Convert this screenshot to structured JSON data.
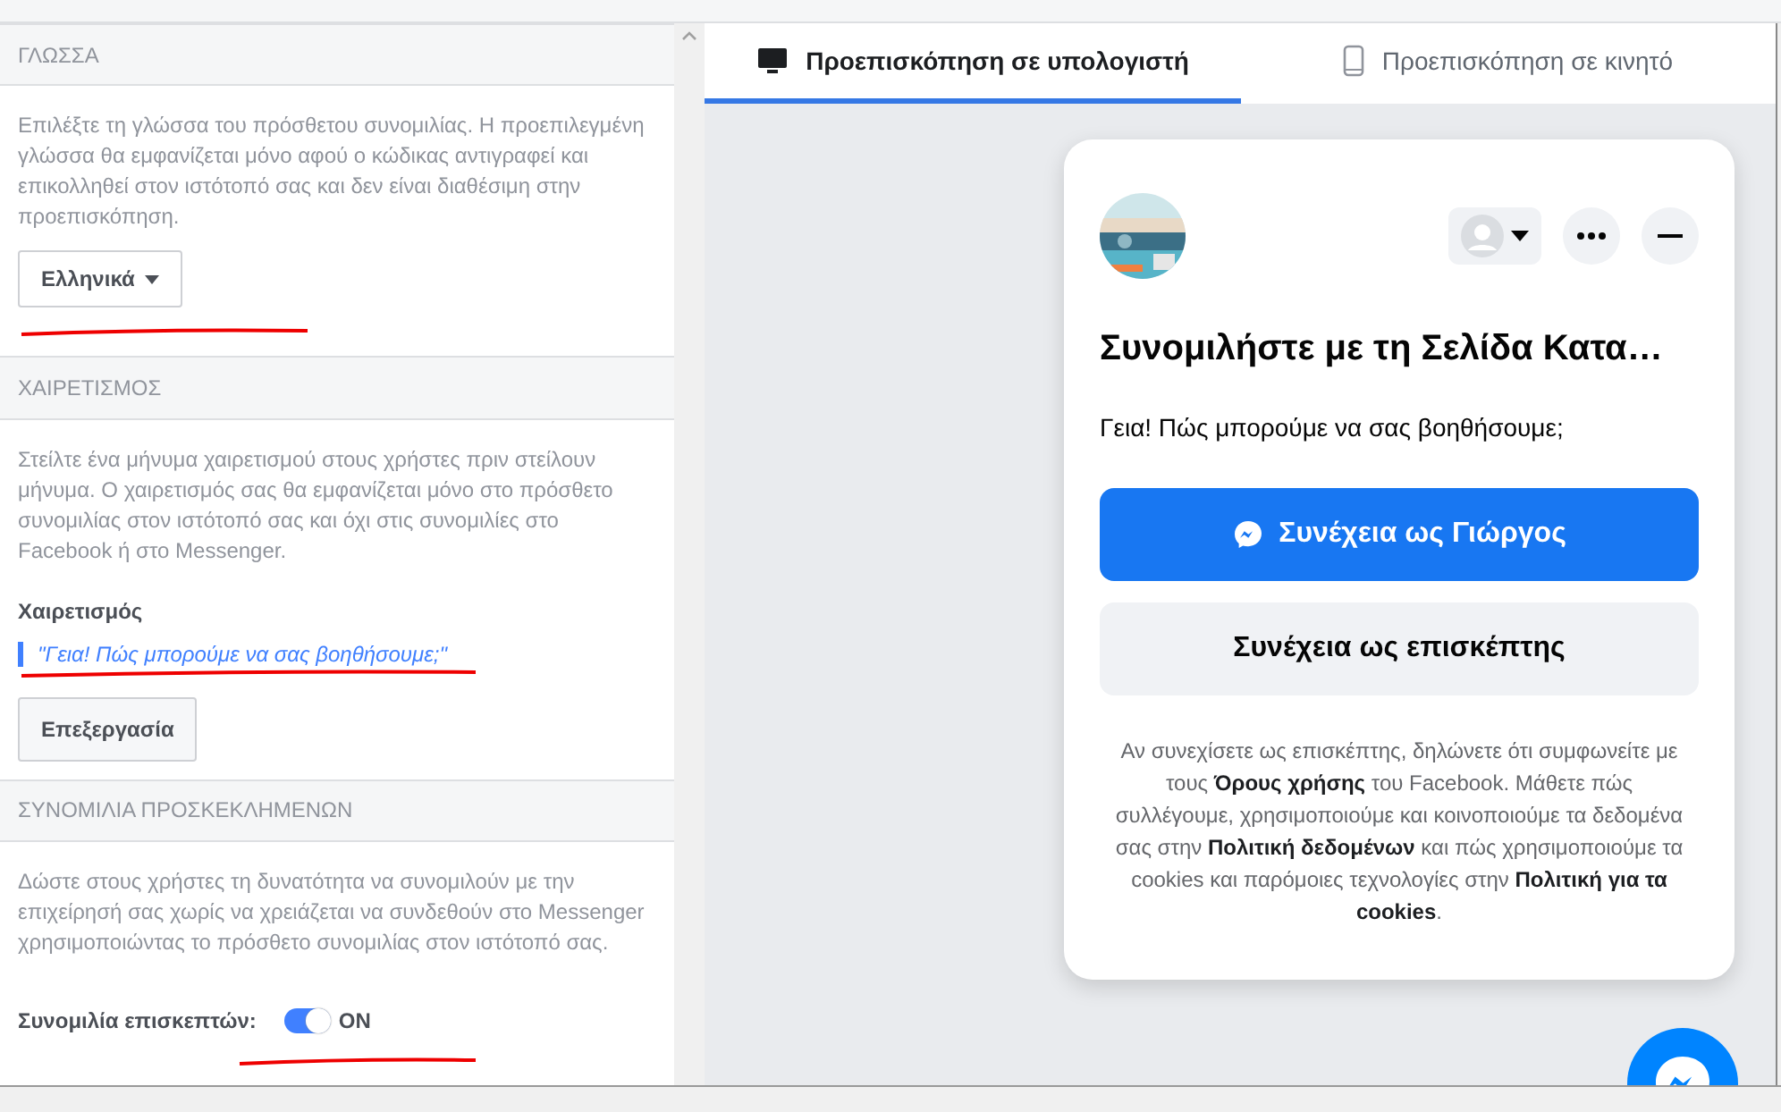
{
  "settings": {
    "sections": [
      {
        "kind": "language",
        "title": "ΓΛΩΣΣΑ",
        "description": "Επιλέξτε τη γλώσσα του πρόσθετου συνομιλίας. Η προεπιλεγμένη γλώσσα θα εμφανίζεται μόνο αφού ο κώδικας αντιγραφεί και επικολληθεί στον ιστότοπό σας και δεν είναι διαθέσιμη στην προεπισκόπηση.",
        "dropdown": "Ελληνικά"
      },
      {
        "kind": "greeting",
        "title": "ΧΑΙΡΕΤΙΣΜΟΣ",
        "description": "Στείλτε ένα μήνυμα χαιρετισμού στους χρήστες πριν στείλουν μήνυμα. Ο χαιρετισμός σας θα εμφανίζεται μόνο στο πρόσθετο συνομιλίας στον ιστότοπό σας και όχι στις συνομιλίες στο Facebook ή στο Messenger.",
        "label": "Χαιρετισμός",
        "quote": "\"Γεια! Πώς μπορούμε να σας βοηθήσουμε;\"",
        "button": "Επεξεργασία"
      },
      {
        "kind": "guest",
        "title": "ΣΥΝΟΜΙΛΙΑ ΠΡΟΣΚΕΚΛΗΜΕΝΩΝ",
        "description": "Δώστε στους χρήστες τη δυνατότητα να συνομιλούν με την επιχείρησή σας χωρίς να χρειάζεται να συνδεθούν στο Messenger χρησιμοποιώντας το πρόσθετο συνομιλίας στον ιστότοπό σας.",
        "label": "Συνομιλία επισκεπτών:",
        "toggle": {
          "on": true,
          "text": "ON"
        }
      }
    ]
  },
  "preview": {
    "tabs": [
      {
        "kind": "desktop",
        "label": "Προεπισκόπηση σε υπολογιστή",
        "selected": true
      },
      {
        "kind": "mobile",
        "label": "Προεπισκόπηση σε κινητό",
        "selected": false
      }
    ],
    "card": {
      "title": "Συνομιλήστε με τη Σελίδα Κατα…",
      "greeting": "Γεια! Πώς μπορούμε να σας βοηθήσουμε;",
      "primary_button": "Συνέχεια ως Γιώργος",
      "secondary_button": "Συνέχεια ως επισκέπτης",
      "legal": "Αν συνεχίσετε ως επισκέπτης, δηλώνετε ότι συμφωνείτε με τους **Όρους χρήσης** του Facebook. Μάθετε πώς συλλέγουμε, χρησιμοποιούμε και κοινοποιούμε τα δεδομένα σας στην **Πολιτική δεδομένων** και πώς χρησιμοποιούμε τα cookies και παρόμοιες τεχνολογίες στην **Πολιτική για τα cookies**."
    }
  }
}
